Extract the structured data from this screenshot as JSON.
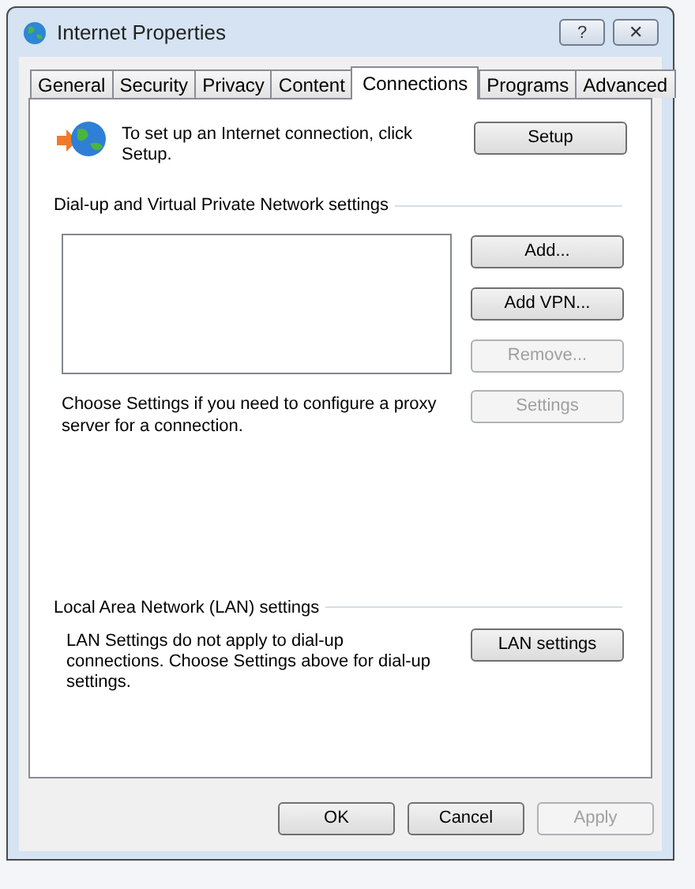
{
  "window": {
    "title": "Internet Properties",
    "title_buttons": [
      "?",
      "✕"
    ]
  },
  "tabs": [
    {
      "label": "General",
      "selected": false
    },
    {
      "label": "Security",
      "selected": false
    },
    {
      "label": "Privacy",
      "selected": false
    },
    {
      "label": "Content",
      "selected": false
    },
    {
      "label": "Connections",
      "selected": true
    },
    {
      "label": "Programs",
      "selected": false
    },
    {
      "label": "Advanced",
      "selected": false
    }
  ],
  "setup": {
    "text": "To set up an Internet connection, click Setup.",
    "button": "Setup"
  },
  "vpn_group": {
    "label": "Dial-up and Virtual Private Network settings",
    "buttons": [
      {
        "label": "Add...",
        "disabled": false
      },
      {
        "label": "Add VPN...",
        "disabled": false
      },
      {
        "label": "Remove...",
        "disabled": true
      }
    ],
    "proxy_text": "Choose Settings if you need to configure a proxy server for a connection.",
    "settings_button": {
      "label": "Settings",
      "disabled": true
    }
  },
  "lan_group": {
    "label": "Local Area Network (LAN) settings",
    "text": "LAN Settings do not apply to dial-up connections. Choose Settings above for dial-up settings.",
    "button": "LAN settings"
  },
  "dialog_buttons": [
    {
      "label": "OK",
      "disabled": false
    },
    {
      "label": "Cancel",
      "disabled": false
    },
    {
      "label": "Apply",
      "disabled": true
    }
  ]
}
